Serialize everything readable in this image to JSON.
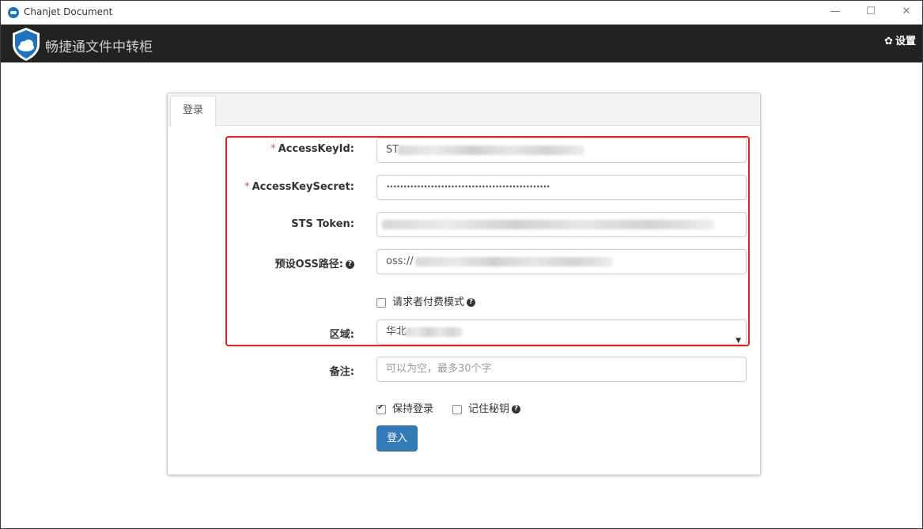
{
  "window": {
    "title": "Chanjet Document",
    "min": "—",
    "max": "☐",
    "close": "✕"
  },
  "header": {
    "brand": "畅捷通文件中转柜",
    "settings_label": "设置"
  },
  "tabs": [
    {
      "label": "登录"
    }
  ],
  "form": {
    "access_key_id": {
      "label": "AccessKeyId:",
      "required": "*",
      "value": "ST"
    },
    "access_key_secret": {
      "label": "AccessKeySecret:",
      "required": "*",
      "value": "••••••••••••••••••••••••••••••••••••••••••••••••"
    },
    "sts_token": {
      "label": "STS Token:",
      "value": ""
    },
    "oss_path": {
      "label": "预设OSS路径:",
      "value": "oss://"
    },
    "requester_pays": {
      "label": "请求者付费模式",
      "checked": false
    },
    "region": {
      "label": "区域:",
      "value": "华北"
    },
    "note": {
      "label": "备注:",
      "placeholder": "可以为空，最多30个字"
    },
    "keep_login": {
      "label": "保持登录",
      "checked": true
    },
    "remember_secret": {
      "label": "记住秘钥",
      "checked": false
    },
    "login_button": "登入"
  },
  "icons": {
    "help": "?"
  },
  "colors": {
    "header_bg": "#222222",
    "primary": "#337ab7",
    "highlight": "#e0241b",
    "required": "#d9534f"
  }
}
